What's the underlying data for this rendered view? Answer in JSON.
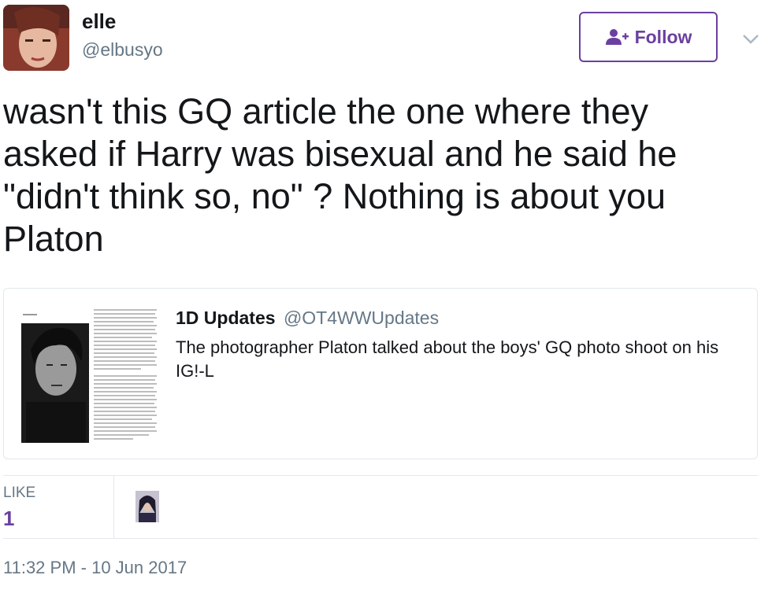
{
  "author": {
    "display_name": "elle",
    "handle": "@elbusyo"
  },
  "follow_button": {
    "label": "Follow"
  },
  "tweet": {
    "text": "wasn't this GQ article the one where they asked if Harry was bisexual and he said he \"didn't think so, no\" ? Nothing is about you Platon"
  },
  "quoted_tweet": {
    "display_name": "1D Updates",
    "handle": "@OT4WWUpdates",
    "text": "The photographer Platon talked about the boys' GQ photo shoot on his IG!-L"
  },
  "stats": {
    "likes_label": "LIKE",
    "likes_count": "1"
  },
  "timestamp": "11:32 PM - 10 Jun 2017",
  "colors": {
    "accent": "#6b3fa0",
    "muted": "#657786",
    "border": "#e1e8ed"
  }
}
